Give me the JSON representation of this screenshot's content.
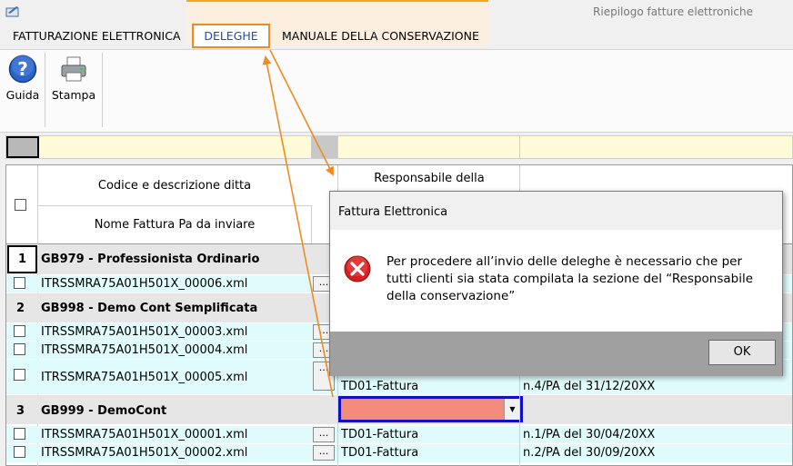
{
  "window": {
    "title": "Riepilogo fatture elettroniche"
  },
  "tabs": [
    {
      "label": "FATTURAZIONE ELETTRONICA"
    },
    {
      "label": "DELEGHE"
    },
    {
      "label": "MANUALE DELLA CONSERVAZIONE"
    }
  ],
  "ribbon": {
    "guida_label": "Guida",
    "stampa_label": "Stampa"
  },
  "grid": {
    "header": {
      "col_codice": "Codice e descrizione ditta",
      "col_nome": "Nome Fattura Pa da inviare",
      "col_responsabile": "Responsabile della"
    },
    "groups": [
      {
        "num": "1",
        "title": "GB979 - Professionista Ordinario",
        "files": [
          {
            "name": "ITRSSMRA75A01H501X_00006.xml",
            "tipo": "",
            "numero": ""
          }
        ]
      },
      {
        "num": "2",
        "title": "GB998 - Demo Cont Semplificata",
        "files": [
          {
            "name": "ITRSSMRA75A01H501X_00003.xml",
            "tipo": "",
            "numero": ""
          },
          {
            "name": "ITRSSMRA75A01H501X_00004.xml",
            "tipo": "",
            "numero": ""
          },
          {
            "name": "ITRSSMRA75A01H501X_00005.xml",
            "tipo": "TD01-Fattura",
            "numero": "n.4/PA del 31/12/20XX"
          }
        ]
      },
      {
        "num": "3",
        "title": "GB999 - DemoCont",
        "files": [
          {
            "name": "ITRSSMRA75A01H501X_00001.xml",
            "tipo": "TD01-Fattura",
            "numero": "n.1/PA del 30/04/20XX"
          },
          {
            "name": "ITRSSMRA75A01H501X_00002.xml",
            "tipo": "TD01-Fattura",
            "numero": "n.2/PA del 30/09/20XX"
          }
        ]
      }
    ],
    "dots_label": "..."
  },
  "dialog": {
    "title": "Fattura Elettronica",
    "message": "Per procedere all’invio delle deleghe è necessario che per tutti clienti sia stata compilata la sezione del “Responsabile della conservazione”",
    "ok_label": "OK",
    "icon": "error-icon"
  },
  "colors": {
    "annotation_orange": "#f08a24",
    "highlight_blue": "#1010c8",
    "error_red_cell": "#f38b7d",
    "filter_bar": "#fffbd9",
    "file_row": "#e0fbfb"
  }
}
